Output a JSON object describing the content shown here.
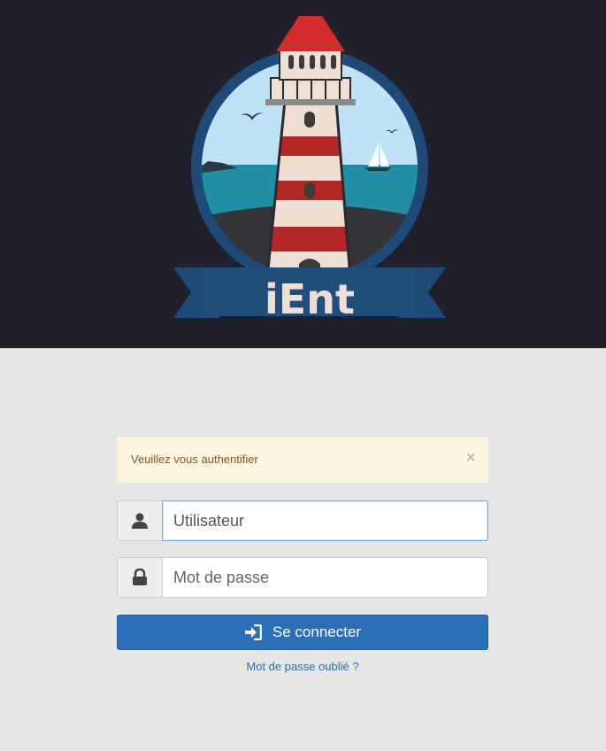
{
  "header": {
    "logo_text": "iEnt"
  },
  "alert": {
    "message": "Veuillez vous authentifier",
    "close_label": "×"
  },
  "login": {
    "username_placeholder": "Utilisateur",
    "password_placeholder": "Mot de passe",
    "submit_label": "Se connecter",
    "forgot_label": "Mot de passe oublié ?"
  },
  "icons": {
    "username": "user-icon",
    "password": "lock-icon",
    "submit": "sign-in-icon",
    "close": "close-icon"
  },
  "colors": {
    "header_bg": "#1f2029",
    "page_bg": "#e6e6e6",
    "alert_bg": "#fcf6de",
    "primary": "#2a70b8",
    "link": "#2a6eaf"
  }
}
